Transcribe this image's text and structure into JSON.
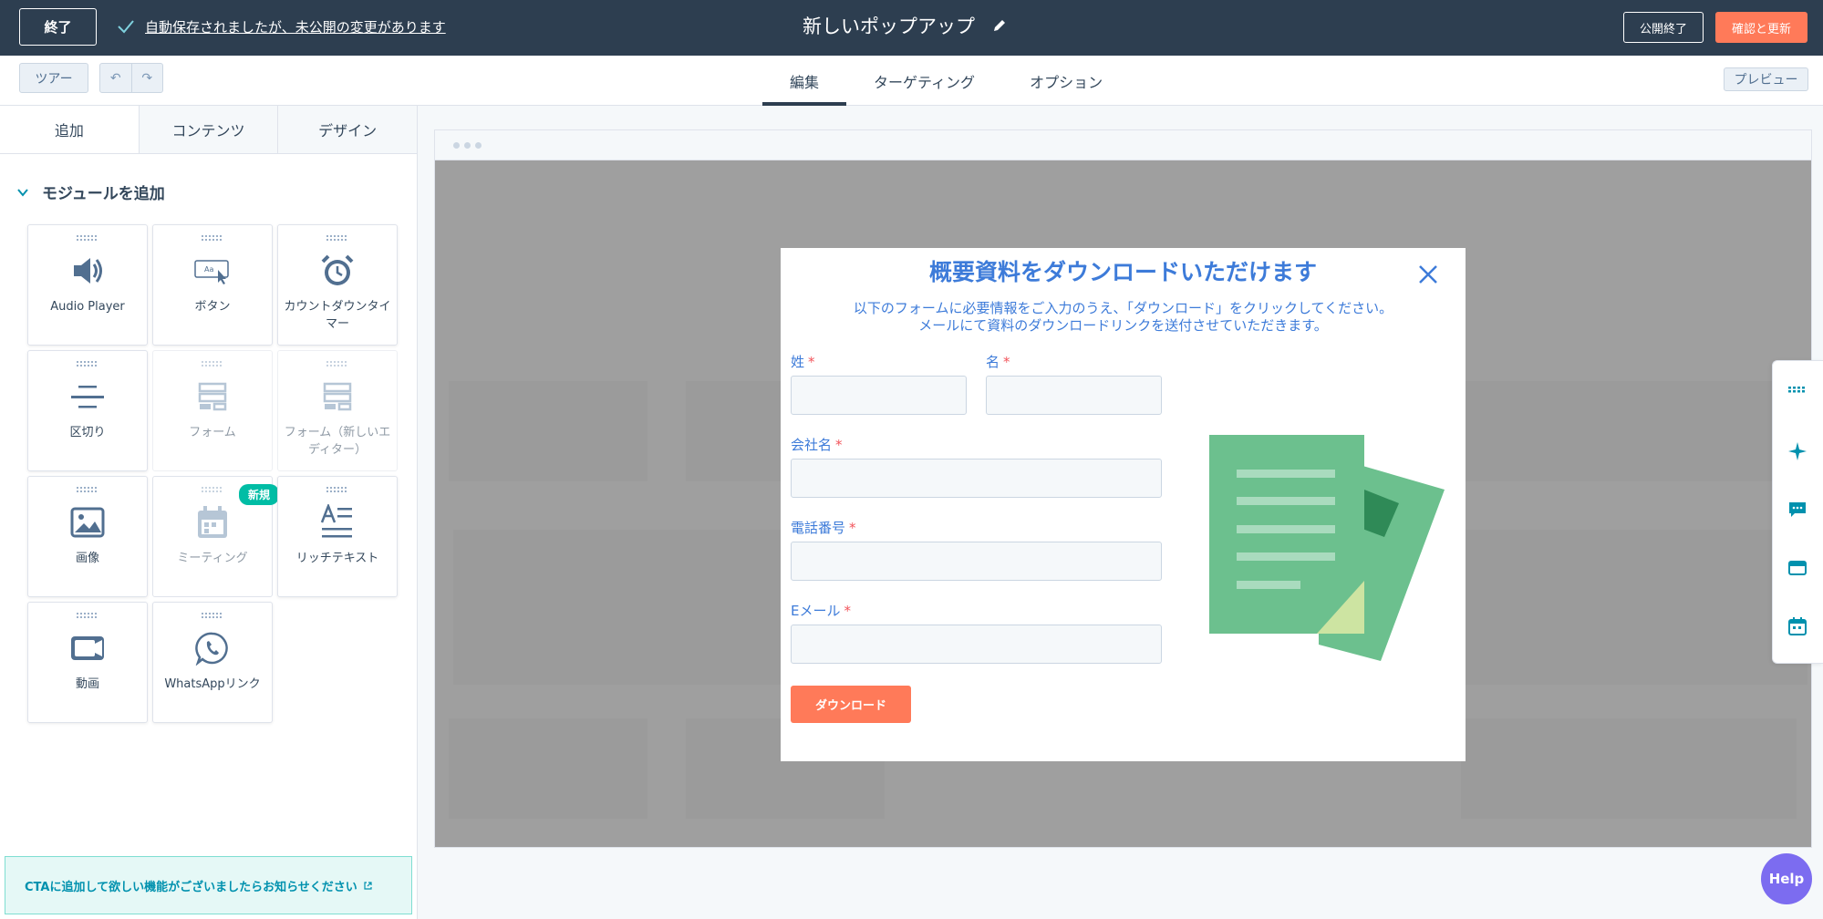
{
  "topbar": {
    "exit_label": "終了",
    "autosave_text": "自動保存されましたが、未公開の変更があります",
    "title": "新しいポップアップ",
    "unpublish_label": "公開終了",
    "review_label": "確認と更新"
  },
  "subbar": {
    "tour_label": "ツアー",
    "tabs": [
      "編集",
      "ターゲティング",
      "オプション"
    ],
    "active_tab": "編集",
    "preview_label": "プレビュー"
  },
  "sidebar": {
    "tabs": [
      "追加",
      "コンテンツ",
      "デザイン"
    ],
    "active_tab": "追加",
    "section_title": "モジュールを追加",
    "modules": [
      {
        "label": "Audio Player",
        "icon": "speaker-icon",
        "enabled": true
      },
      {
        "label": "ボタン",
        "icon": "button-cursor-icon",
        "enabled": true
      },
      {
        "label": "カウントダウンタイマー",
        "icon": "alarm-clock-icon",
        "enabled": true
      },
      {
        "label": "区切り",
        "icon": "divider-icon",
        "enabled": true
      },
      {
        "label": "フォーム",
        "icon": "form-icon",
        "enabled": false
      },
      {
        "label": "フォーム（新しいエディター）",
        "icon": "form-icon",
        "enabled": false
      },
      {
        "label": "画像",
        "icon": "image-icon",
        "enabled": true
      },
      {
        "label": "ミーティング",
        "icon": "calendar-icon",
        "enabled": false,
        "badge": "新規"
      },
      {
        "label": "リッチテキスト",
        "icon": "rich-text-icon",
        "enabled": true
      },
      {
        "label": "動画",
        "icon": "video-camera-icon",
        "enabled": true
      },
      {
        "label": "WhatsAppリンク",
        "icon": "whatsapp-icon",
        "enabled": true
      }
    ],
    "notice_text": "CTAに追加して欲しい機能がございましたらお知らせください"
  },
  "popup": {
    "title": "概要資料をダウンロードいただけます",
    "description_line1": "以下のフォームに必要情報をご入力のうえ、「ダウンロード」をクリックしてください。",
    "description_line2": "メールにて資料のダウンロードリンクを送付させていただきます。",
    "fields": {
      "last_name": "姓",
      "first_name": "名",
      "company": "会社名",
      "phone": "電話番号",
      "email": "Eメール"
    },
    "required_mark": "*",
    "download_label": "ダウンロード"
  },
  "help_label": "Help",
  "colors": {
    "topbar": "#2d3e50",
    "accent": "#ff7a59",
    "popup_text": "#3d7bd9",
    "help": "#7c6cf0",
    "badge": "#00bda5"
  }
}
